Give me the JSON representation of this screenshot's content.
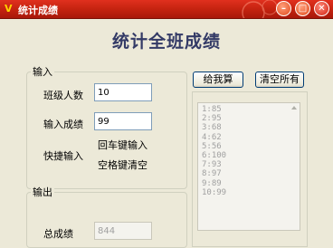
{
  "window": {
    "title": "统计成绩",
    "icon_glyph": "V",
    "min_glyph": "–",
    "max_glyph": "□",
    "close_glyph": "✕"
  },
  "heading": "统计全班成绩",
  "input_group": {
    "label": "输入",
    "class_size_label": "班级人数",
    "class_size_value": "10",
    "score_label": "输入成绩",
    "score_value": "99",
    "shortcut_label": "快捷输入",
    "shortcut_enter": "回车键输入",
    "shortcut_space": "空格键清空"
  },
  "output_group": {
    "label": "输出",
    "total_label": "总成绩",
    "total_value": "844"
  },
  "buttons": {
    "calc": "给我算",
    "clear": "清空所有"
  },
  "score_list": [
    "1:85",
    "2:95",
    "3:68",
    "4:62",
    "5:56",
    "6:100",
    "7:93",
    "8:97",
    "9:89",
    "10:99"
  ],
  "colors": {
    "titlebar": "#c2220f",
    "heading": "#333a66",
    "window_bg": "#ece9d8"
  }
}
